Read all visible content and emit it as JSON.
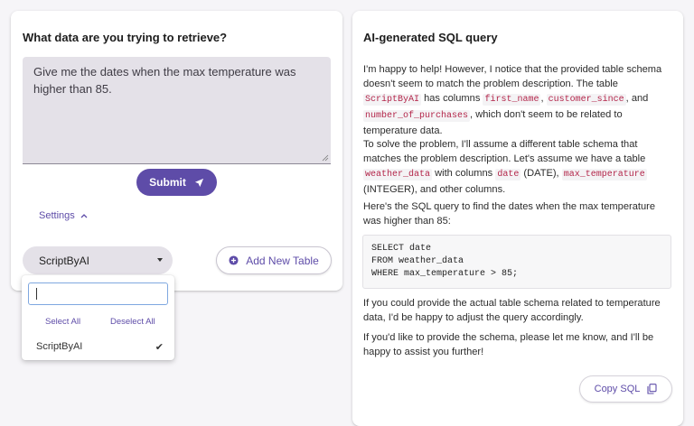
{
  "left_panel": {
    "title": "What data are you trying to retrieve?",
    "query_text": "Give me the dates when the max temperature was higher than 85.",
    "submit_label": "Submit",
    "settings_label": "Settings",
    "table_select_value": "ScriptByAI",
    "add_table_label": "Add New Table",
    "dropdown": {
      "search_value": "",
      "select_all_label": "Select All",
      "deselect_all_label": "Deselect All",
      "options": [
        {
          "label": "ScriptByAI",
          "selected": true
        }
      ]
    }
  },
  "right_panel": {
    "title": "AI-generated SQL query",
    "p1": {
      "t1": "I'm happy to help! However, I notice that the provided table schema doesn't seem to match the problem description. The table ",
      "c1": "ScriptByAI",
      "t2": " has columns ",
      "c2": "first_name",
      "t3": ", ",
      "c3": "customer_since",
      "t4": ", and ",
      "c4": "number_of_purchases",
      "t5": ", which don't seem to be related to temperature data."
    },
    "p2": {
      "t1": "To solve the problem, I'll assume a different table schema that matches the problem description. Let's assume we have a table ",
      "c1": "weather_data",
      "t2": " with columns ",
      "c2": "date",
      "t3": " (DATE), ",
      "c3": "max_temperature",
      "t4": " (INTEGER), and other columns."
    },
    "p3": "Here's the SQL query to find the dates when the max temperature was higher than 85:",
    "code": "SELECT date\nFROM weather_data\nWHERE max_temperature > 85;",
    "p4": "If you could provide the actual table schema related to temperature data, I'd be happy to adjust the query accordingly.",
    "p5": "If you'd like to provide the schema, please let me know, and I'll be happy to assist you further!",
    "copy_label": "Copy SQL"
  },
  "colors": {
    "accent": "#5e4ca8",
    "code_text": "#b3264a",
    "input_bg": "#e4e1e8"
  },
  "icons": [
    "send-icon",
    "chevron-up-icon",
    "caret-down-icon",
    "plus-circle-icon",
    "checkmark-icon",
    "copy-icon",
    "resize-grip-icon"
  ]
}
